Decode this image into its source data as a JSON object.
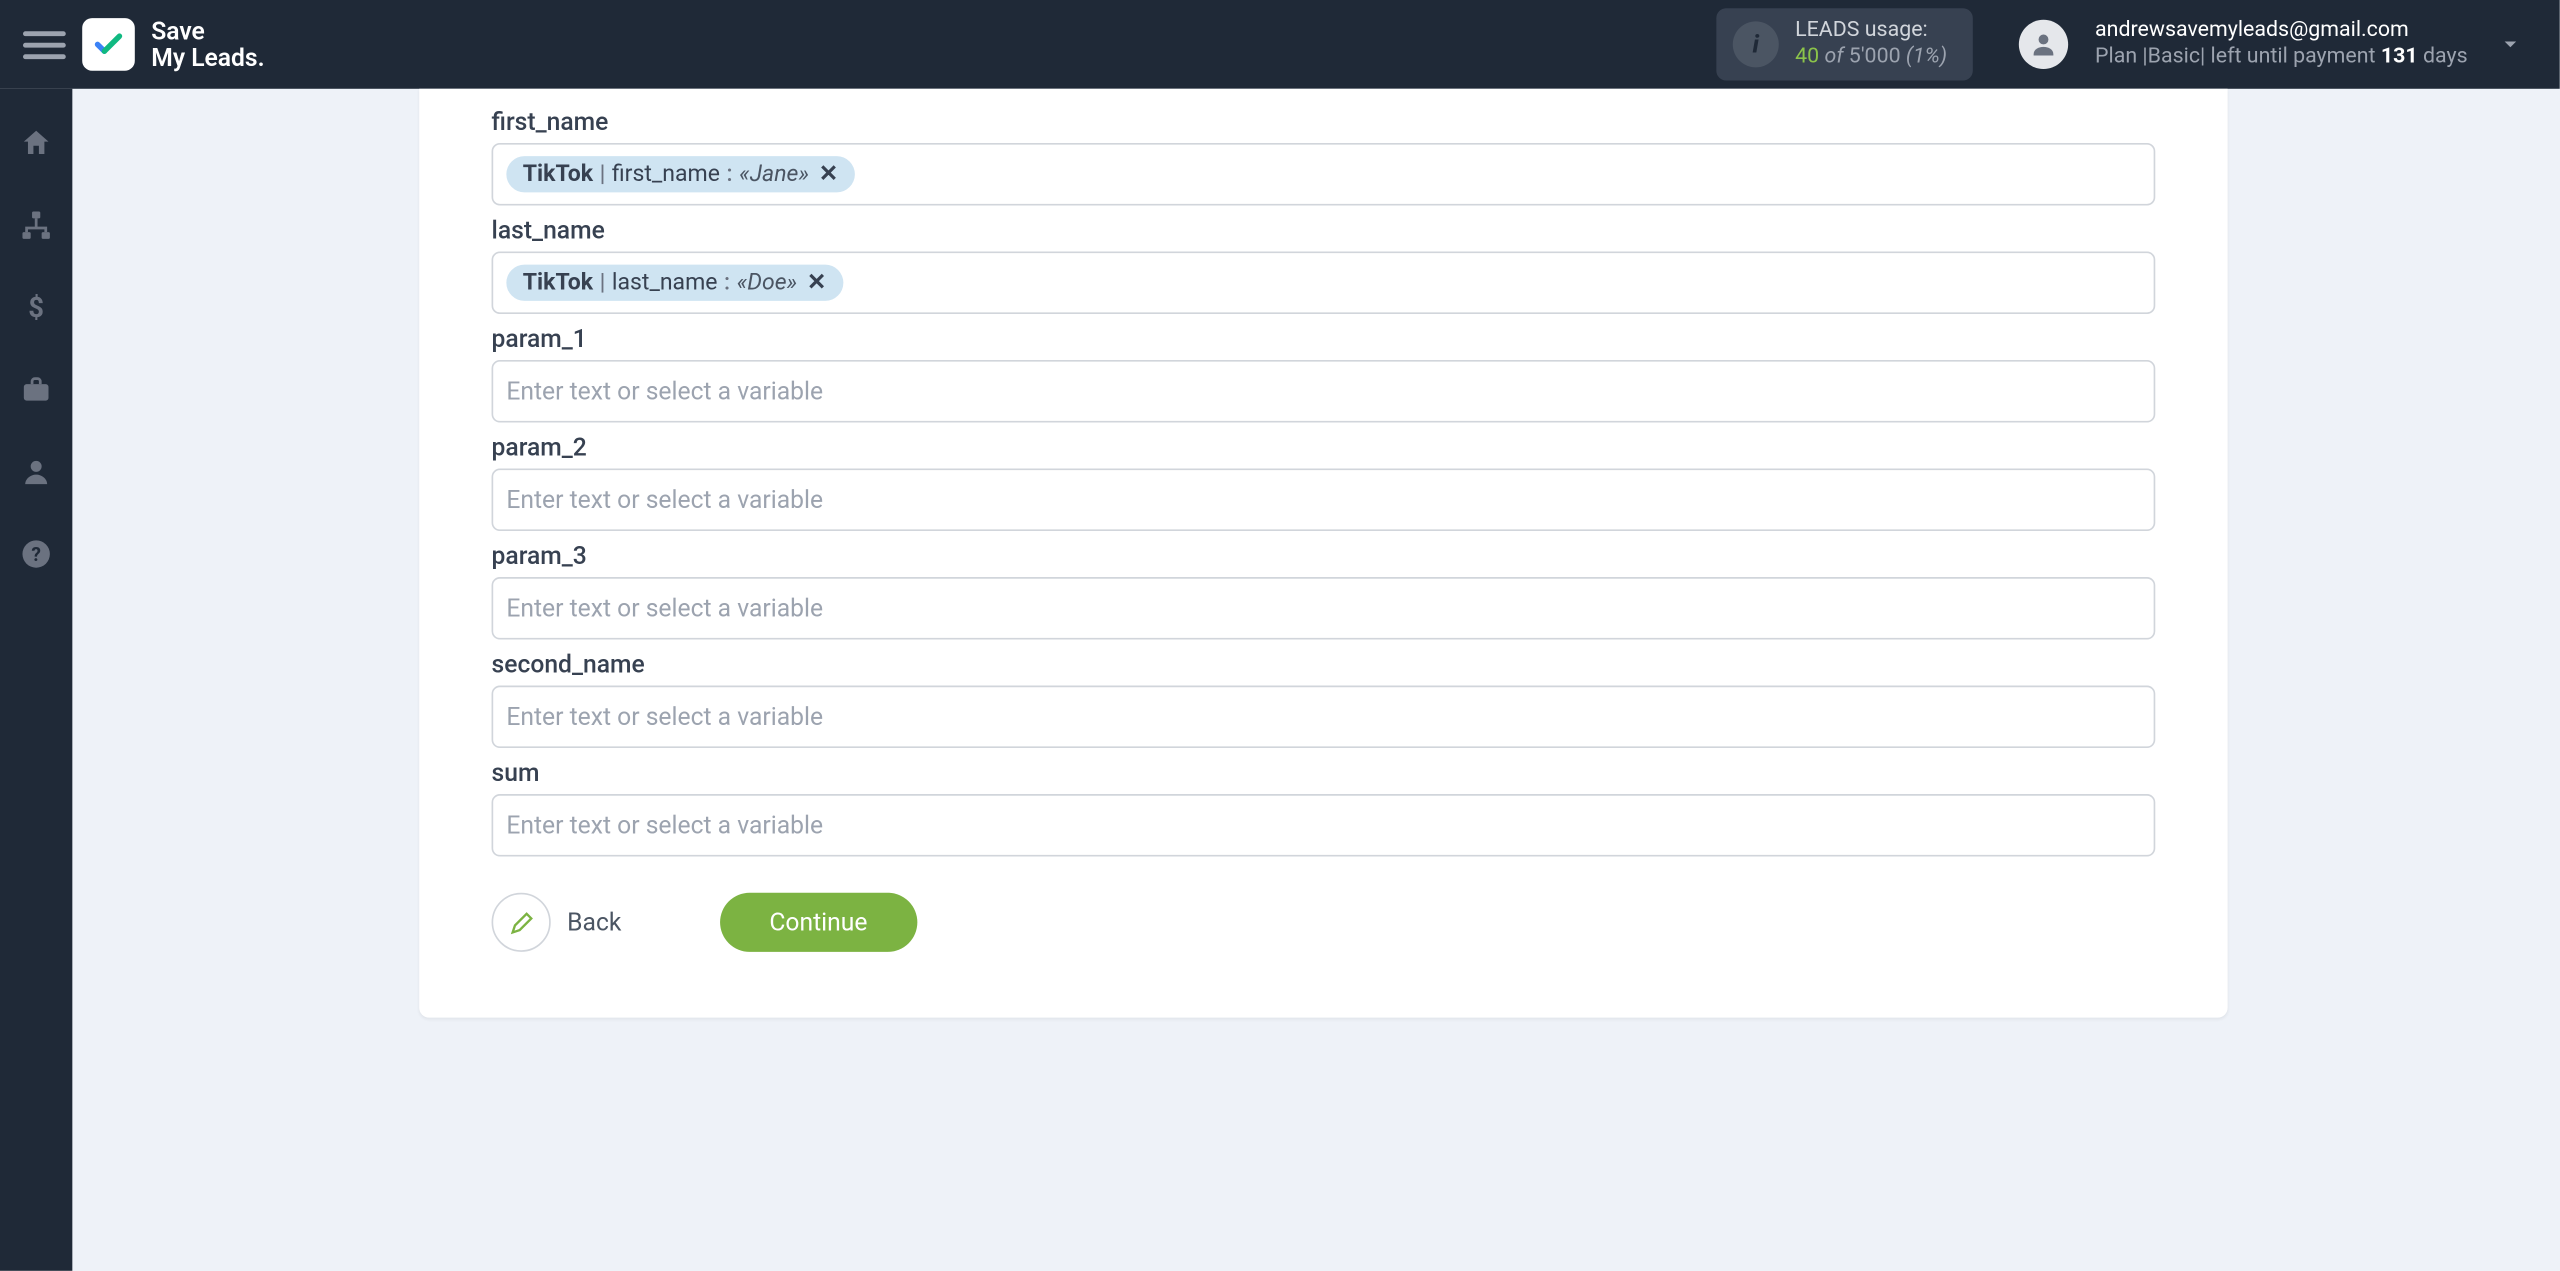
{
  "brand": {
    "l1": "Save",
    "l2": "My Leads."
  },
  "usage": {
    "label": "LEADS usage:",
    "count": "40",
    "of_word": "of",
    "limit": "5'000",
    "pct": "(1%)"
  },
  "account": {
    "email": "andrewsavemyleads@gmail.com",
    "plan_prefix": "Plan |",
    "plan_name": "Basic",
    "plan_mid": "| left until payment ",
    "days": "131",
    "days_word": " days"
  },
  "icons": {
    "info": "i"
  },
  "fields": [
    {
      "label": "first_name",
      "chip": {
        "source": "TikTok",
        "key": "first_name",
        "value": "«Jane»"
      }
    },
    {
      "label": "last_name",
      "chip": {
        "source": "TikTok",
        "key": "last_name",
        "value": "«Doe»"
      }
    },
    {
      "label": "param_1",
      "placeholder": "Enter text or select a variable"
    },
    {
      "label": "param_2",
      "placeholder": "Enter text or select a variable"
    },
    {
      "label": "param_3",
      "placeholder": "Enter text or select a variable"
    },
    {
      "label": "second_name",
      "placeholder": "Enter text or select a variable"
    },
    {
      "label": "sum",
      "placeholder": "Enter text or select a variable"
    }
  ],
  "buttons": {
    "back": "Back",
    "continue": "Continue"
  }
}
